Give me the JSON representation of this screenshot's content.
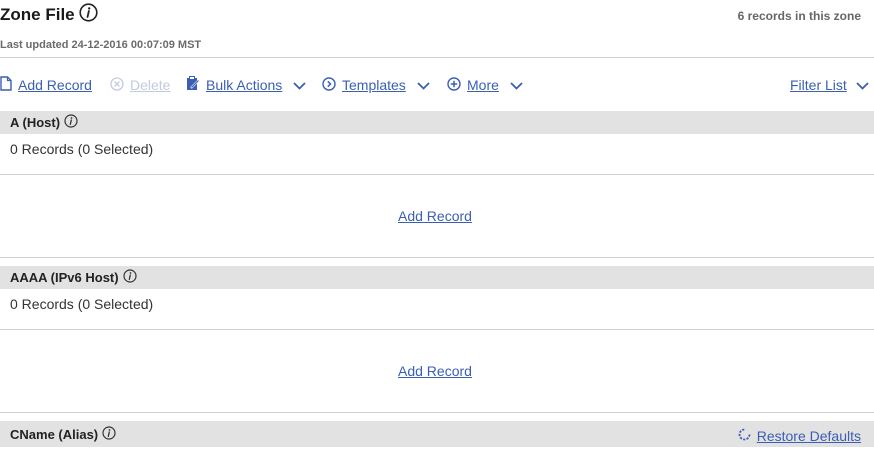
{
  "header": {
    "title": "Zone File",
    "records_count": "6 records in this zone",
    "last_updated": "Last updated 24-12-2016 00:07:09 MST"
  },
  "toolbar": {
    "add_record": "Add Record",
    "delete": "Delete",
    "bulk_actions": "Bulk Actions",
    "templates": "Templates",
    "more": "More",
    "filter_list": "Filter List"
  },
  "sections": [
    {
      "title": "A (Host)",
      "count_text": "0 Records (0 Selected)",
      "add_label": "Add Record"
    },
    {
      "title": "AAAA (IPv6 Host)",
      "count_text": "0 Records (0 Selected)",
      "add_label": "Add Record"
    },
    {
      "title": "CName (Alias)",
      "restore_label": "Restore Defaults"
    }
  ],
  "colors": {
    "link": "#3a5fb3",
    "section_bg": "#e2e2e2",
    "disabled": "#c2cbe0"
  }
}
